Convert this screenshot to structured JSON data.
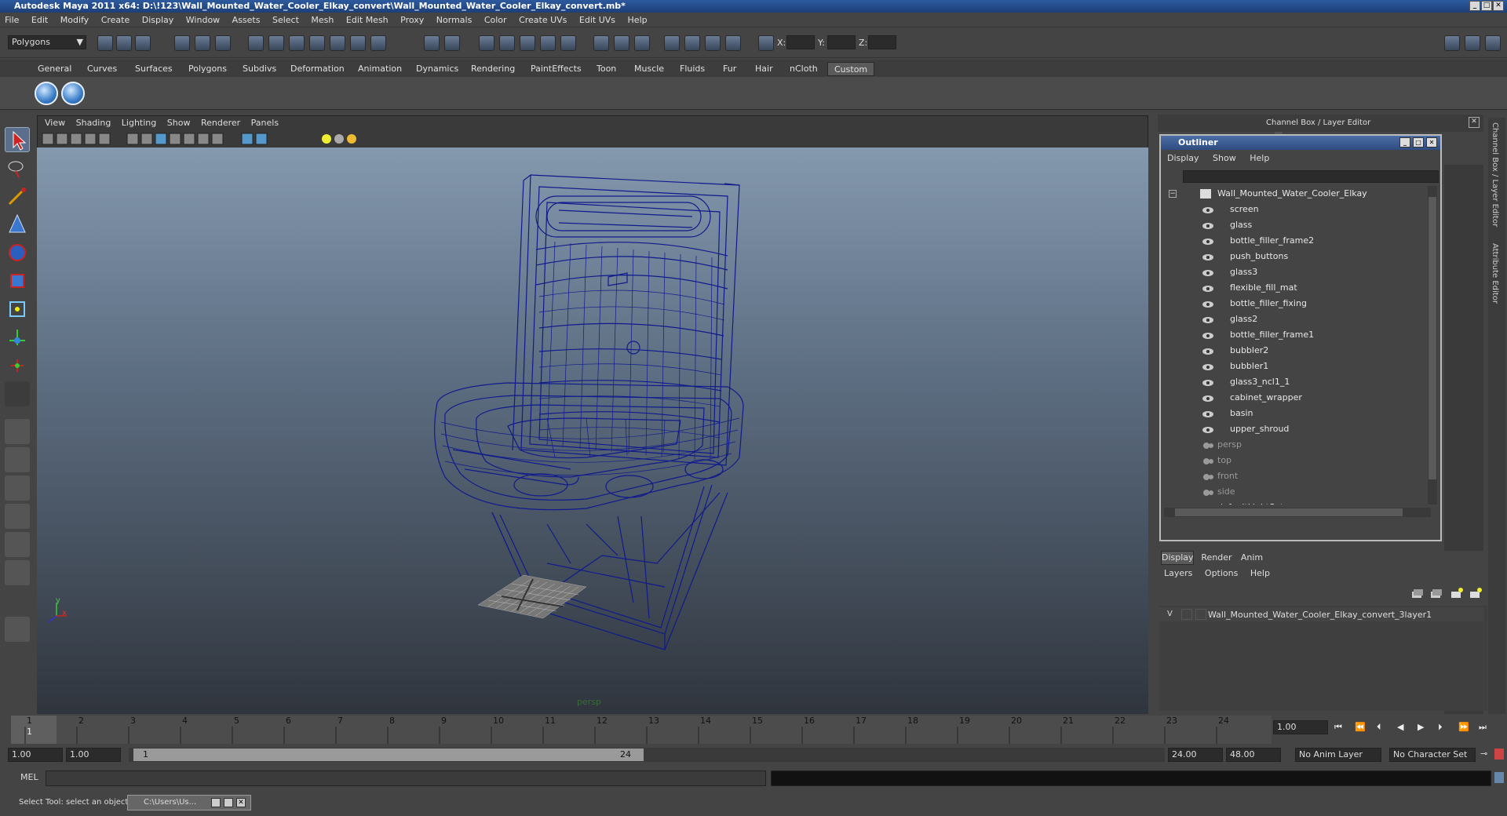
{
  "window": {
    "title": "Autodesk Maya 2011 x64: D:\\!123\\Wall_Mounted_Water_Cooler_Elkay_convert\\Wall_Mounted_Water_Cooler_Elkay_convert.mb*"
  },
  "menubar": [
    "File",
    "Edit",
    "Modify",
    "Create",
    "Display",
    "Window",
    "Assets",
    "Select",
    "Mesh",
    "Edit Mesh",
    "Proxy",
    "Normals",
    "Color",
    "Create UVs",
    "Edit UVs",
    "Help"
  ],
  "statusline": {
    "mode": "Polygons",
    "x_label": "X:",
    "y_label": "Y:",
    "z_label": "Z:"
  },
  "shelf_tabs": [
    "General",
    "Curves",
    "Surfaces",
    "Polygons",
    "Subdivs",
    "Deformation",
    "Animation",
    "Dynamics",
    "Rendering",
    "PaintEffects",
    "Toon",
    "Muscle",
    "Fluids",
    "Fur",
    "Hair",
    "nCloth",
    "Custom"
  ],
  "shelf_active": "Custom",
  "viewport": {
    "menus": [
      "View",
      "Shading",
      "Lighting",
      "Show",
      "Renderer",
      "Panels"
    ],
    "camera_label": "persp",
    "axis_y": "y",
    "axis_x": "x"
  },
  "channel_box": {
    "title": "Channel Box / Layer Editor",
    "side_tabs": [
      "Channel Box / Layer Editor",
      "Attribute Editor"
    ]
  },
  "outliner": {
    "title": "Outliner",
    "menus": [
      "Display",
      "Show",
      "Help"
    ],
    "root": "Wall_Mounted_Water_Cooler_Elkay",
    "children": [
      "screen",
      "glass",
      "bottle_filler_frame2",
      "push_buttons",
      "glass3",
      "flexible_fill_mat",
      "bottle_filler_fixing",
      "glass2",
      "bottle_filler_frame1",
      "bubbler2",
      "bubbler1",
      "glass3_ncl1_1",
      "cabinet_wrapper",
      "basin",
      "upper_shroud"
    ],
    "cameras": [
      "persp",
      "top",
      "front",
      "side"
    ],
    "sets": [
      "defaultLightSet"
    ]
  },
  "layer_editor": {
    "tabs": [
      "Display",
      "Render",
      "Anim"
    ],
    "active_tab": "Display",
    "menus": [
      "Layers",
      "Options",
      "Help"
    ],
    "layer": {
      "visible": "V",
      "name": "Wall_Mounted_Water_Cooler_Elkay_convert_3layer1"
    }
  },
  "timeline": {
    "ticks": [
      "1",
      "2",
      "3",
      "4",
      "5",
      "6",
      "7",
      "8",
      "9",
      "10",
      "11",
      "12",
      "13",
      "14",
      "15",
      "16",
      "17",
      "18",
      "19",
      "20",
      "21",
      "22",
      "23",
      "24"
    ],
    "current_frame": "1",
    "current_time_field": "1.00"
  },
  "range": {
    "start": "1.00",
    "playback_start": "1.00",
    "slider_start": "1",
    "slider_end": "24",
    "playback_end": "24.00",
    "end": "48.00",
    "anim_layer": "No Anim Layer",
    "character_set": "No Character Set"
  },
  "command": {
    "label": "MEL"
  },
  "helpline": {
    "text": "Select Tool: select an object",
    "taskbar_item": "C:\\Users\\Us..."
  }
}
